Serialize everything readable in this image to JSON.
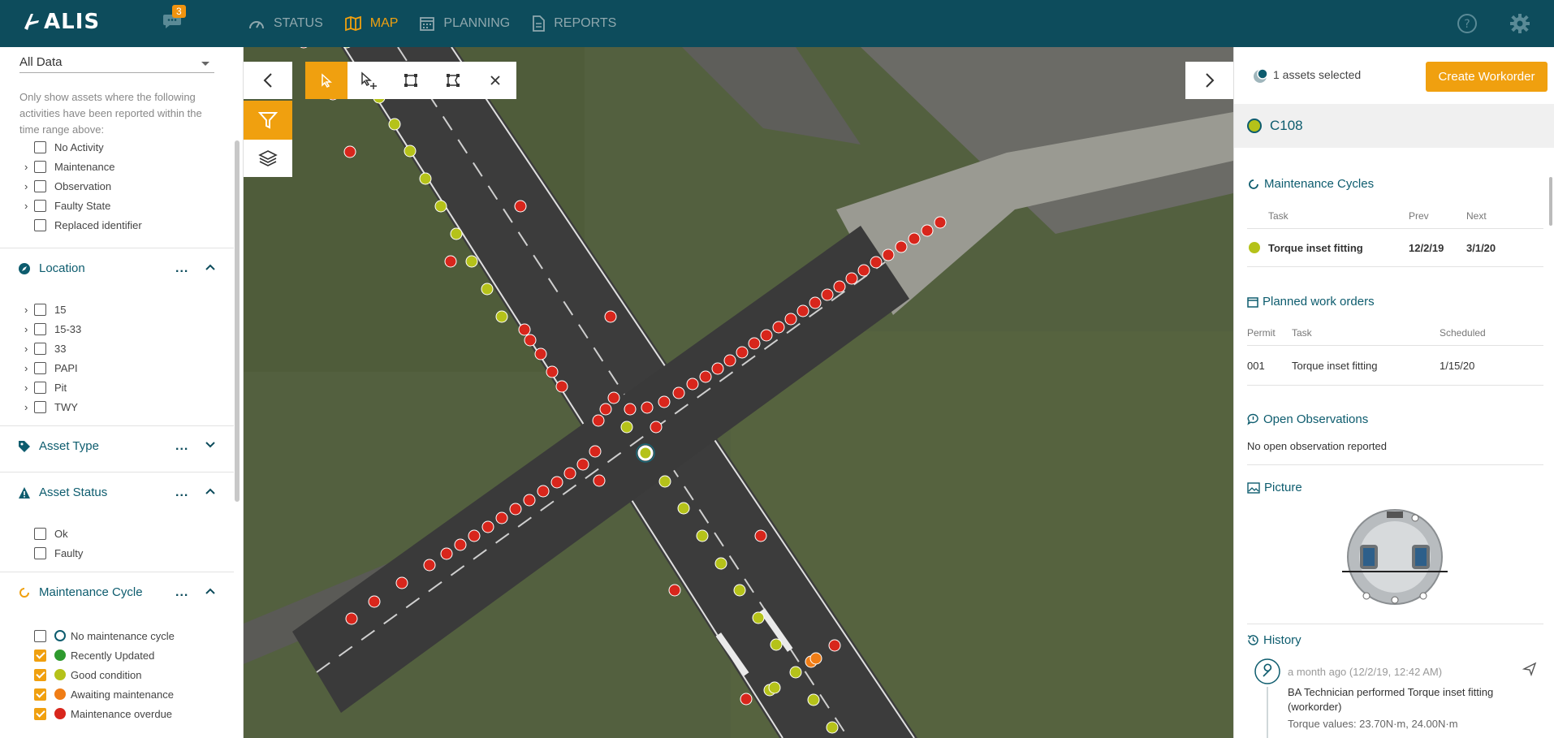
{
  "topbar": {
    "logo": "ALIS",
    "messages_badge": "3",
    "nav": [
      {
        "label": "STATUS",
        "icon": "gauge-icon",
        "active": false
      },
      {
        "label": "MAP",
        "icon": "map-icon",
        "active": true
      },
      {
        "label": "PLANNING",
        "icon": "calendar-icon",
        "active": false
      },
      {
        "label": "REPORTS",
        "icon": "document-icon",
        "active": false
      }
    ]
  },
  "sidebar": {
    "data_filter": "All Data",
    "activity_hint": "Only show assets where the following activities have been reported within the time range above:",
    "activities": [
      "No Activity",
      "Maintenance",
      "Observation",
      "Faulty State",
      "Replaced identifier"
    ],
    "location": {
      "title": "Location",
      "items": [
        "15",
        "15-33",
        "33",
        "PAPI",
        "Pit",
        "TWY"
      ]
    },
    "asset_type": {
      "title": "Asset Type"
    },
    "asset_status": {
      "title": "Asset Status",
      "items": [
        "Ok",
        "Faulty"
      ]
    },
    "maintenance_cycle": {
      "title": "Maintenance Cycle",
      "items": [
        {
          "label": "No maintenance cycle",
          "checked": false,
          "color": "#ffffff"
        },
        {
          "label": "Recently Updated",
          "checked": true,
          "color": "#2e9a2e"
        },
        {
          "label": "Good condition",
          "checked": true,
          "color": "#b5c21a"
        },
        {
          "label": "Awaiting maintenance",
          "checked": true,
          "color": "#f07d16"
        },
        {
          "label": "Maintenance overdue",
          "checked": true,
          "color": "#d8261c"
        }
      ]
    },
    "more": "..."
  },
  "right_panel": {
    "selected_text": "1 assets selected",
    "create_button": "Create Workorder",
    "asset_name": "C108",
    "maintenance_cycles": {
      "title": "Maintenance Cycles",
      "headers": {
        "task": "Task",
        "prev": "Prev",
        "next": "Next"
      },
      "rows": [
        {
          "task": "Torque inset fitting",
          "prev": "12/2/19",
          "next": "3/1/20"
        }
      ]
    },
    "planned_work_orders": {
      "title": "Planned work orders",
      "headers": {
        "permit": "Permit",
        "task": "Task",
        "scheduled": "Scheduled"
      },
      "rows": [
        {
          "permit": "001",
          "task": "Torque inset fitting",
          "scheduled": "1/15/20"
        }
      ]
    },
    "open_observations": {
      "title": "Open Observations",
      "text": "No open observation reported"
    },
    "picture": {
      "title": "Picture"
    },
    "history": {
      "title": "History",
      "entry_time": "a month ago (12/2/19, 12:42 AM)",
      "entry_text": "BA Technician performed Torque inset fitting (workorder)",
      "entry_values": "Torque values: 23.70N·m, 24.00N·m"
    }
  },
  "colors": {
    "header": "#0d4c5c",
    "accent": "#f0a00f",
    "overdue": "#d8261c",
    "good": "#b5c21a",
    "awaiting": "#f07d16"
  }
}
